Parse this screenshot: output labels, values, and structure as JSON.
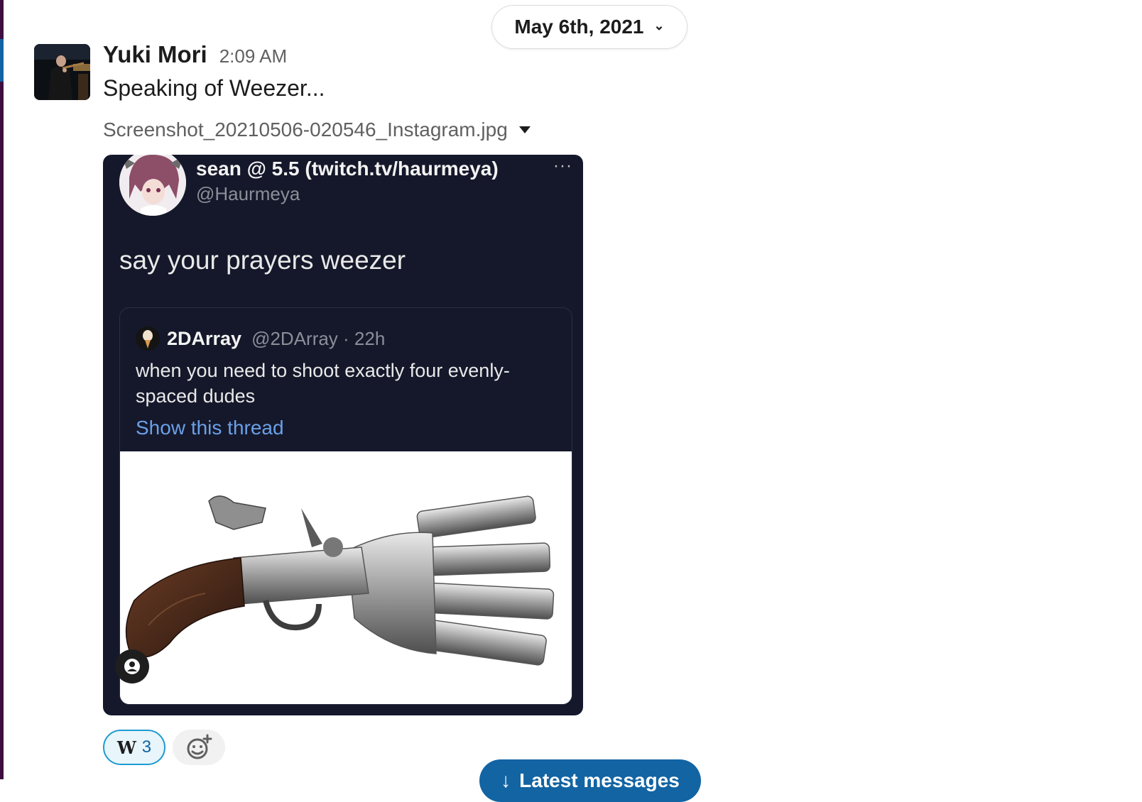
{
  "date_divider": {
    "label": "May 6th, 2021",
    "icon": "chevron-down-icon"
  },
  "message": {
    "author": "Yuki Mori",
    "time": "2:09 AM",
    "text": "Speaking of Weezer...",
    "file": {
      "name": "Screenshot_20210506-020546_Instagram.jpg",
      "icon": "caret-down-icon"
    }
  },
  "screenshot": {
    "tweet": {
      "name": "sean @ 5.5 (twitch.tv/haurmeya)",
      "handle": "@Haurmeya",
      "more": "···",
      "text": "say your prayers weezer"
    },
    "quote": {
      "name": "2DArray",
      "handle": "@2DArray · 22h",
      "text": "when you need to shoot exactly four evenly-spaced dudes",
      "link": "Show this thread",
      "image_alt": "four-barreled flintlock pistol"
    }
  },
  "reactions": [
    {
      "emoji": "W",
      "count": "3"
    }
  ],
  "add_reaction_icon": "add-emoji-icon",
  "latest_button": {
    "arrow": "↓",
    "label": "Latest messages"
  },
  "colors": {
    "accent": "#1264a3",
    "reaction_border": "#1d9bd1",
    "sidebar": "#3f0e40"
  }
}
